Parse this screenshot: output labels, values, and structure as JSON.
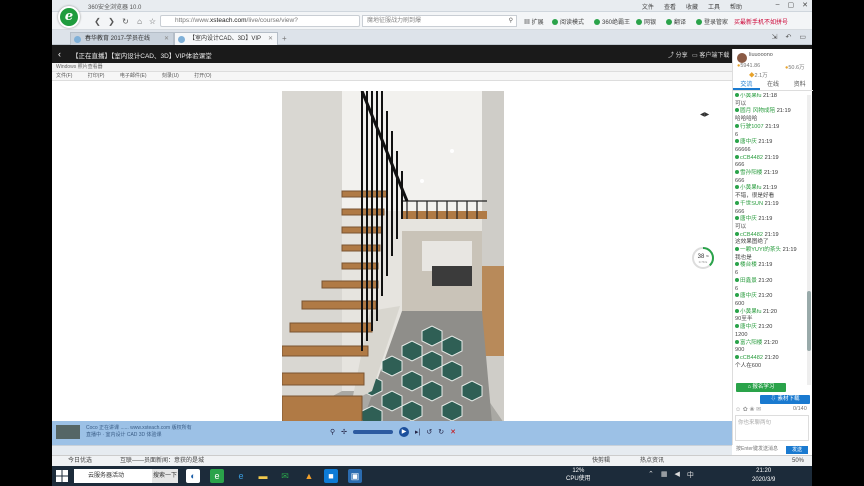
{
  "browser": {
    "title": "360安全浏览器 10.0",
    "menus": [
      "文件",
      "查看",
      "收藏",
      "工具",
      "帮助"
    ],
    "url_prefix": "https://www.",
    "url_host": "xsteach.com",
    "url_path": "/live/course/view?",
    "search_placeholder": "魔地征服战力刷到爆",
    "ext": {
      "expand": "扩展",
      "read_mode": "阅读模式",
      "guard": "360绝霸王",
      "translate": "网银",
      "fanyi": "翻译",
      "login": "登录管家",
      "promo": "买最新手机不如拼号"
    },
    "tabs": [
      {
        "label": "春华教育 2017-学员在线"
      },
      {
        "label": "【室内设计CAD、3D】VIP"
      }
    ]
  },
  "page": {
    "course_title": "【正在直播】【室内设计CAD、3D】VIP体验课堂",
    "share": "分享",
    "client_download": "客户端下载",
    "video_toolbar1": "Windows 照片查看器",
    "video_toolbar2": [
      "文件(F)",
      "打印(P)",
      "电子邮件(E)",
      "刻录(U)",
      "打开(O)"
    ],
    "progress_value": "38",
    "progress_unit": "%",
    "progress_rate": "0.7K/s",
    "ticker_line1": "Coco   正在讲课 ......   www.xsteach.com   版权所有",
    "ticker_line2": "直播中 · 室内设计 CAD 3D 体验课",
    "marker_text": "◀▶"
  },
  "side": {
    "username": "liuuooono",
    "coins": "5941.86",
    "points": "50.6万",
    "level": "2.1万",
    "tabs": [
      "交流",
      "在线",
      "资料"
    ],
    "messages": [
      {
        "who": "小黄果fu",
        "time": "21:18",
        "text": "可以"
      },
      {
        "who": "圆月 风物成陪",
        "time": "21:19",
        "text": "哈哈哈哈"
      },
      {
        "who": "行驶1007",
        "time": "21:19",
        "text": "6"
      },
      {
        "who": "唐中庆",
        "time": "21:19",
        "text": "66666"
      },
      {
        "who": "cCB4482",
        "time": "21:19",
        "text": "666"
      },
      {
        "who": "雪孙阳楼",
        "time": "21:19",
        "text": "666"
      },
      {
        "who": "小黄果fu",
        "time": "21:19",
        "text": "不错，很是好看"
      },
      {
        "who": "千世SUN",
        "time": "21:19",
        "text": "666"
      },
      {
        "who": "唐中庆",
        "time": "21:19",
        "text": "可以"
      },
      {
        "who": "cCB4482",
        "time": "21:19",
        "text": "这效果图绝了"
      },
      {
        "who": "一颗YUYI的茶头",
        "time": "21:19",
        "text": "我也是"
      },
      {
        "who": "楼台楼",
        "time": "21:19",
        "text": "6"
      },
      {
        "who": "田鑫景",
        "time": "21:20",
        "text": "6"
      },
      {
        "who": "唐中庆",
        "time": "21:20",
        "text": "600"
      },
      {
        "who": "小黄果fu",
        "time": "21:20",
        "text": "90至半"
      },
      {
        "who": "唐中庆",
        "time": "21:20",
        "text": "1200"
      },
      {
        "who": "富六阳楼",
        "time": "21:20",
        "text": "900"
      },
      {
        "who": "cCB4482",
        "time": "21:20",
        "text": "个人在600"
      }
    ],
    "btn_study": "报名学习",
    "btn_download": "素材下载",
    "counter": "0/140",
    "input_placeholder": "你也来聊两句",
    "send_hint": "按Enter键发送消息",
    "send_btn": "发送"
  },
  "statusbar": {
    "today": "今日优选",
    "news": "互联——员面新闻：意获的是城",
    "accel": "快剪辑",
    "hot": "热点资讯",
    "zoom": "50%"
  },
  "taskbar": {
    "search_text": "云服务器活动",
    "search_btn": "搜索一下",
    "cpu_percent": "12%",
    "cpu_label": "CPU使用",
    "time": "21:20",
    "date": "2020/3/9"
  }
}
